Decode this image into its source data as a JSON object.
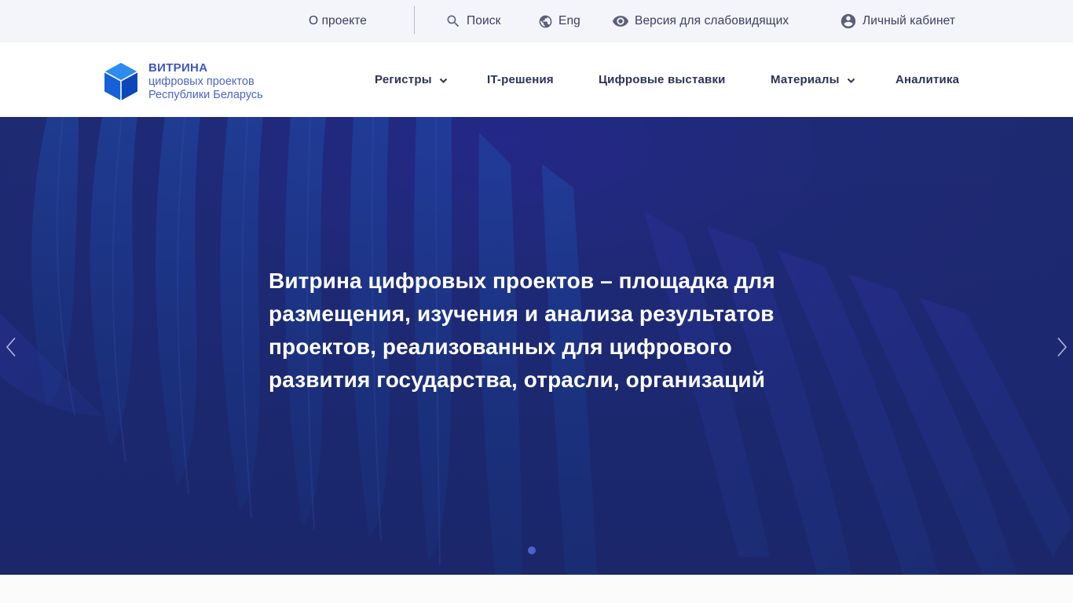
{
  "topbar": {
    "about": "О проекте",
    "search": "Поиск",
    "language": "Eng",
    "accessibility": "Версия для слабовидящих",
    "account": "Личный кабинет"
  },
  "logo": {
    "title": "ВИТРИНА",
    "line2": "цифровых проектов",
    "line3": "Республики Беларусь"
  },
  "nav": {
    "registries": "Регистры",
    "it_solutions": "IT-решения",
    "exhibitions": "Цифровые выставки",
    "materials": "Материалы",
    "analytics": "Аналитика"
  },
  "hero": {
    "text": "Витрина цифровых проектов – площадка для размещения, изучения и анализа результатов проектов, реализованных для цифрового развития государства, отрасли, организаций",
    "slide_count": 1,
    "active_slide": 1
  },
  "colors": {
    "accent": "#3d57c4",
    "hero_background": "#1c2870",
    "topbar_background": "#f4f5fa",
    "nav_text": "#2c3356"
  },
  "icons": {
    "search": "search-icon",
    "language": "globe-icon",
    "accessibility": "eye-icon",
    "account": "user-circle-icon",
    "dropdown": "chevron-down-icon",
    "prev": "chevron-left-icon",
    "next": "chevron-right-icon"
  }
}
